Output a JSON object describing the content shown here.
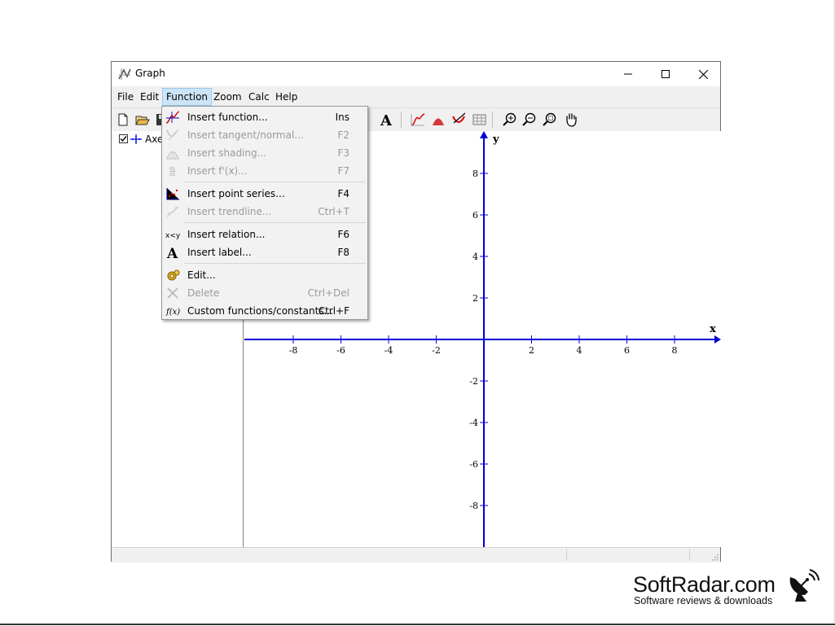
{
  "window": {
    "title": "Graph"
  },
  "menubar": [
    {
      "label": "File"
    },
    {
      "label": "Edit"
    },
    {
      "label": "Function"
    },
    {
      "label": "Zoom"
    },
    {
      "label": "Calc"
    },
    {
      "label": "Help"
    }
  ],
  "tree": {
    "item_label": "Axes",
    "checked": true
  },
  "function_menu": {
    "items": [
      {
        "label": "Insert function...",
        "shortcut": "Ins",
        "enabled": true,
        "icon": "function-icon"
      },
      {
        "label": "Insert tangent/normal...",
        "shortcut": "F2",
        "enabled": false,
        "icon": "tangent-icon"
      },
      {
        "label": "Insert shading...",
        "shortcut": "F3",
        "enabled": false,
        "icon": "shading-icon"
      },
      {
        "label": "Insert f'(x)...",
        "shortcut": "F7",
        "enabled": false,
        "icon": "derivative-icon"
      },
      {
        "label": "Insert point series...",
        "shortcut": "F4",
        "enabled": true,
        "icon": "point-series-icon"
      },
      {
        "label": "Insert trendline...",
        "shortcut": "Ctrl+T",
        "enabled": false,
        "icon": "trendline-icon"
      },
      {
        "label": "Insert relation...",
        "shortcut": "F6",
        "enabled": true,
        "icon": "relation-icon"
      },
      {
        "label": "Insert label...",
        "shortcut": "F8",
        "enabled": true,
        "icon": "label-icon"
      },
      {
        "label": "Edit...",
        "shortcut": "",
        "enabled": true,
        "icon": "edit-gear-icon"
      },
      {
        "label": "Delete",
        "shortcut": "Ctrl+Del",
        "enabled": false,
        "icon": "delete-icon"
      },
      {
        "label": "Custom functions/constants...",
        "shortcut": "Ctrl+F",
        "enabled": true,
        "icon": "custom-function-icon"
      }
    ]
  },
  "plot": {
    "x_axis_label": "x",
    "y_axis_label": "y",
    "x_ticks": [
      "-8",
      "-6",
      "-4",
      "-2",
      "2",
      "4",
      "6",
      "8"
    ],
    "y_ticks": [
      "8",
      "6",
      "4",
      "2",
      "-2",
      "-4",
      "-6",
      "-8"
    ],
    "axis_color": "#0000d8"
  },
  "watermark": {
    "title": "SoftRadar.com",
    "subtitle": "Software reviews & downloads"
  },
  "colors": {
    "menu_highlight": "#cce4f7",
    "axis": "#0000d8",
    "disabled_text": "#9a9a9a"
  }
}
